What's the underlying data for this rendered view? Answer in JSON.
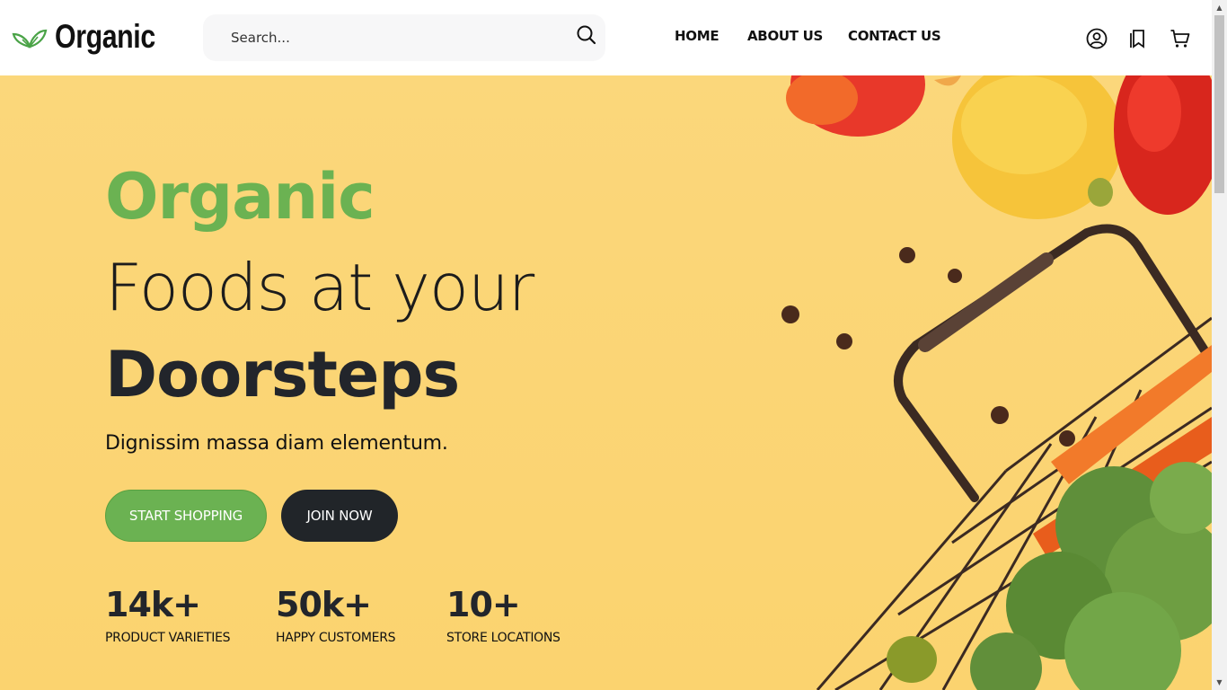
{
  "brand": {
    "name": "Organic",
    "accent": "#6bb252",
    "dark": "#212529"
  },
  "search": {
    "placeholder": "Search..."
  },
  "nav": {
    "items": [
      "HOME",
      "ABOUT US",
      "CONTACT US"
    ]
  },
  "header_icons": [
    "user-icon",
    "bookmark-icon",
    "cart-icon"
  ],
  "hero": {
    "title_line1": "Organic",
    "title_line2": "Foods at your",
    "title_line3": "Doorsteps",
    "subtitle": "Dignissim massa diam elementum.",
    "primary_button": "START SHOPPING",
    "secondary_button": "JOIN NOW",
    "background": "#fbd77b",
    "stats": [
      {
        "value": "14k+",
        "label": "PRODUCT VARIETIES"
      },
      {
        "value": "50k+",
        "label": "HAPPY CUSTOMERS"
      },
      {
        "value": "10+",
        "label": "STORE LOCATIONS"
      }
    ]
  }
}
